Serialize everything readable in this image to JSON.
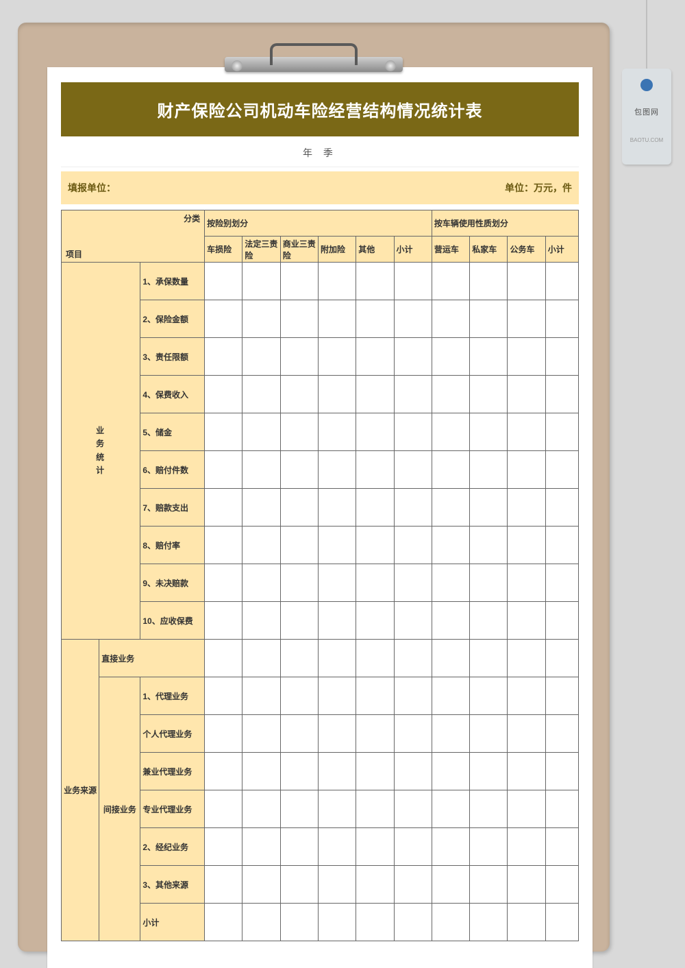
{
  "tag": {
    "text": "包图网",
    "sub": "BAOTU.COM"
  },
  "title": "财产保险公司机动车险经营结构情况统计表",
  "subtitle": "年      季",
  "meta": {
    "left": "填报单位：",
    "right": "单位：万元，件"
  },
  "corner": {
    "top": "分类",
    "bottom": "项目"
  },
  "group1": "按险别划分",
  "group2": "按车辆使用性质划分",
  "cols1": [
    "车损险",
    "法定三责险",
    "商业三责险",
    "附加险",
    "其他",
    "小计"
  ],
  "cols2": [
    "营运车",
    "私家车",
    "公务车",
    "小计"
  ],
  "side1": "业<br>务<br>统<br>计",
  "side2": "业务来源",
  "side2a": "直接业务",
  "side2b": "间接业务",
  "rowsA": [
    "1、承保数量",
    "2、保险金额",
    "3、责任限额",
    "4、保费收入",
    "5、储金",
    "6、赔付件数",
    "7、赔款支出",
    "8、赔付率",
    "9、未决赔款",
    "10、应收保费"
  ],
  "rowsB": [
    "1、代理业务",
    "个人代理业务",
    "兼业代理业务",
    "专业代理业务",
    "2、经纪业务",
    "3、其他来源",
    "小计"
  ]
}
